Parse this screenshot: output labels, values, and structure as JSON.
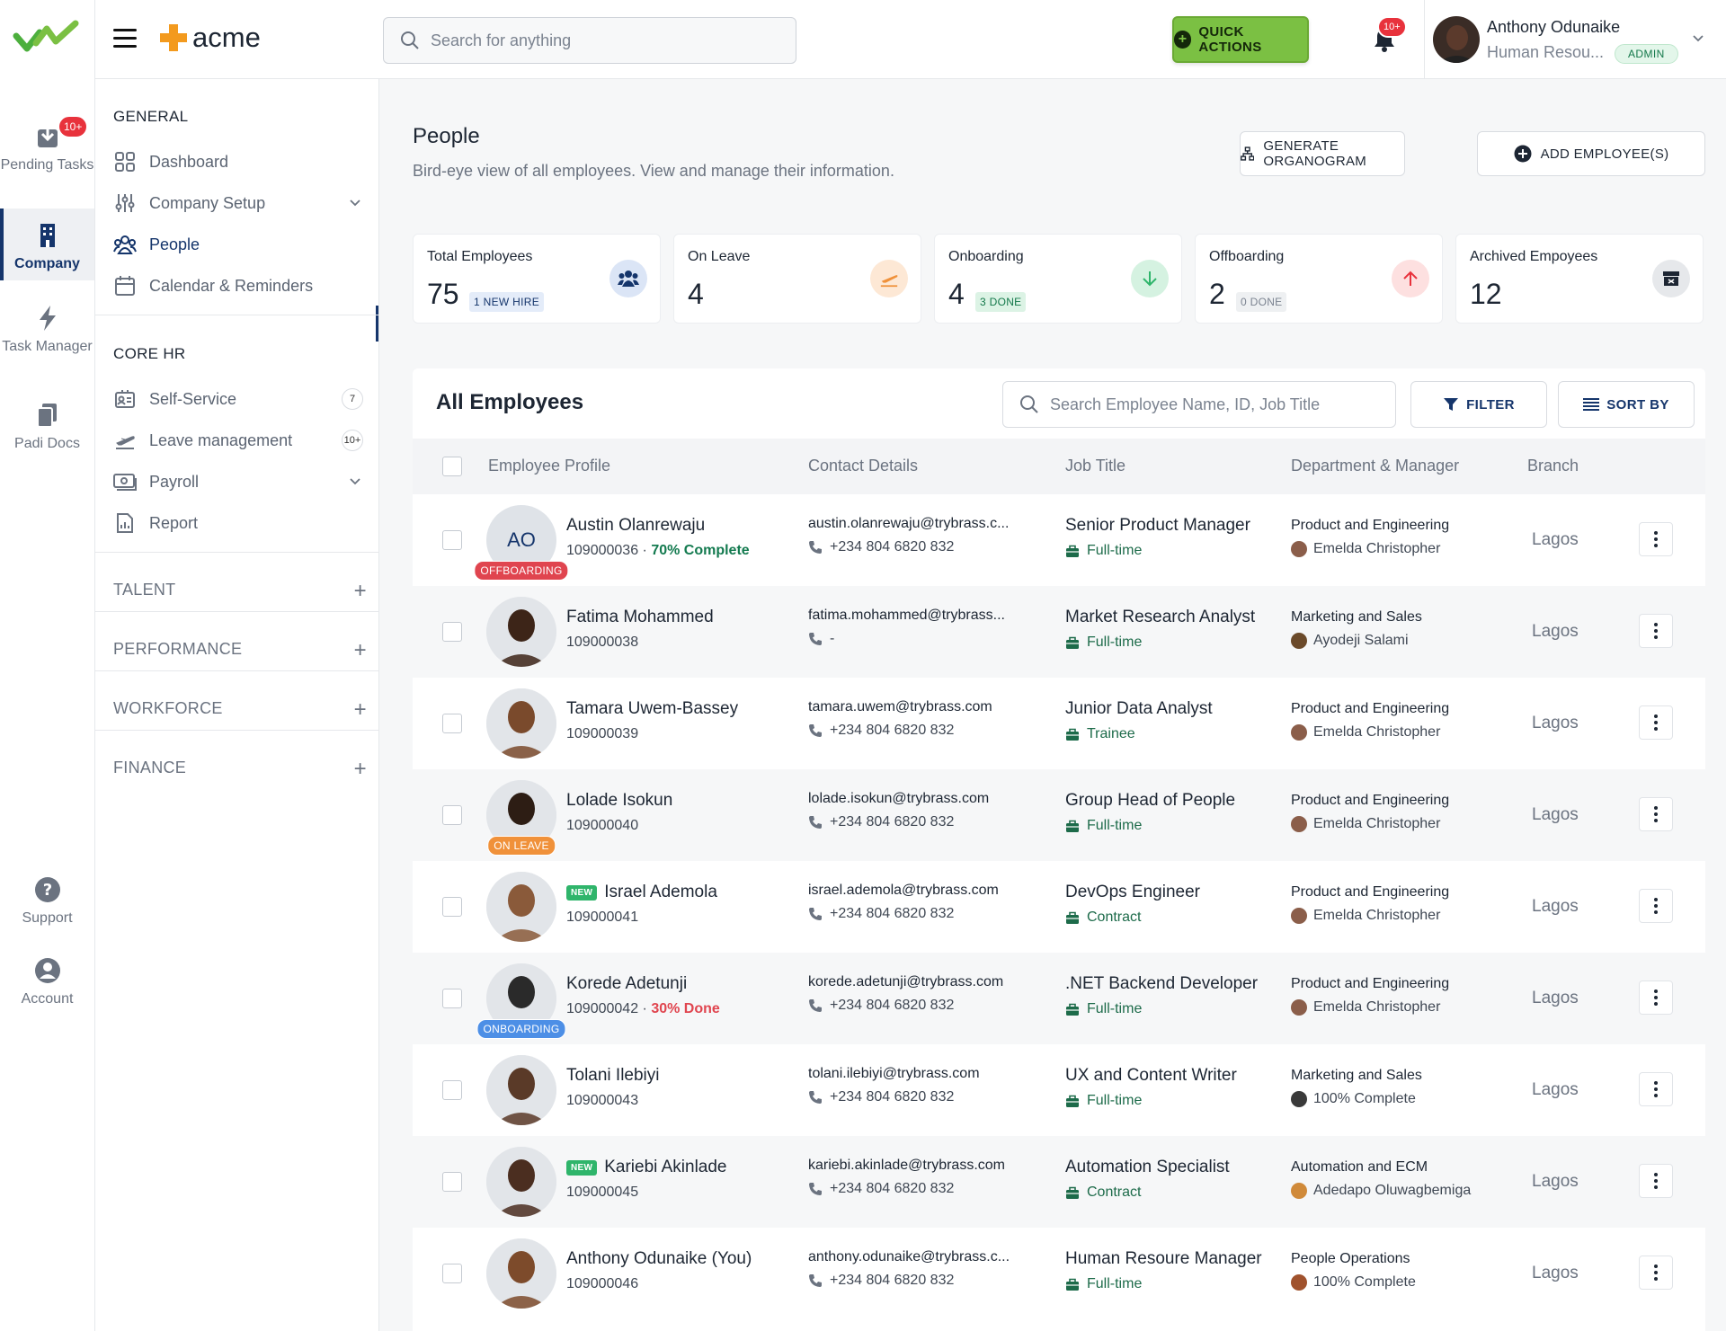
{
  "rail": {
    "pending_tasks": "Pending Tasks",
    "pending_badge": "10+",
    "company": "Company",
    "task_manager": "Task Manager",
    "padi_docs": "Padi Docs",
    "support": "Support",
    "account": "Account"
  },
  "topbar": {
    "brand": "acme",
    "search_placeholder": "Search for anything",
    "quick_actions": "QUICK ACTIONS",
    "notif_badge": "10+",
    "user_name": "Anthony Odunaike",
    "user_role": "Human Resou...",
    "role_badge": "ADMIN"
  },
  "sidebar": {
    "general_heading": "GENERAL",
    "general": [
      {
        "label": "Dashboard"
      },
      {
        "label": "Company Setup"
      },
      {
        "label": "People"
      },
      {
        "label": "Calendar & Reminders"
      }
    ],
    "core_heading": "CORE HR",
    "core": [
      {
        "label": "Self-Service",
        "count": "7"
      },
      {
        "label": "Leave management",
        "count": "10+"
      },
      {
        "label": "Payroll"
      },
      {
        "label": "Report"
      }
    ],
    "sections": [
      "TALENT",
      "PERFORMANCE",
      "WORKFORCE",
      "FINANCE"
    ]
  },
  "page": {
    "title": "People",
    "subtitle": "Bird-eye view of all employees. View and manage their information.",
    "generate_organogram": "GENERATE ORGANOGRAM",
    "add_employee": "ADD EMPLOYEE(S)"
  },
  "stats": [
    {
      "label": "Total Employees",
      "value": "75",
      "pill": "1 NEW HIRE"
    },
    {
      "label": "On Leave",
      "value": "4",
      "pill": ""
    },
    {
      "label": "Onboarding",
      "value": "4",
      "pill": "3 DONE"
    },
    {
      "label": "Offboarding",
      "value": "2",
      "pill": "0 DONE"
    },
    {
      "label": "Archived Empoyees",
      "value": "12",
      "pill": ""
    }
  ],
  "table": {
    "title": "All Employees",
    "search_placeholder": "Search Employee Name, ID, Job Title",
    "filter": "FILTER",
    "sort": "SORT BY",
    "columns": [
      "Employee Profile",
      "Contact Details",
      "Job Title",
      "Department & Manager",
      "Branch"
    ],
    "rows": [
      {
        "initials": "AO",
        "name": "Austin Olanrewaju",
        "new": "",
        "id": "109000036",
        "progress": "70% Complete",
        "progress_color": "#137a4f",
        "status": "OFFBOARDING",
        "status_color": "#e0454f",
        "email": "austin.olanrewaju@trybrass.c...",
        "phone": "+234 804 6820 832",
        "job": "Senior Product Manager",
        "type": "Full-time",
        "dept": "Product and Engineering",
        "manager": "Emelda Christopher",
        "branch": "Lagos"
      },
      {
        "initials": "",
        "name": "Fatima Mohammed",
        "new": "",
        "id": "109000038",
        "progress": "",
        "progress_color": "",
        "status": "",
        "status_color": "",
        "email": "fatima.mohammed@trybrass...",
        "phone": "-",
        "job": "Market Research Analyst",
        "type": "Full-time",
        "dept": "Marketing and Sales",
        "manager": "Ayodeji Salami",
        "branch": "Lagos"
      },
      {
        "initials": "",
        "name": "Tamara Uwem-Bassey",
        "new": "",
        "id": "109000039",
        "progress": "",
        "progress_color": "",
        "status": "",
        "status_color": "",
        "email": "tamara.uwem@trybrass.com",
        "phone": "+234 804 6820 832",
        "job": "Junior Data Analyst",
        "type": "Trainee",
        "dept": "Product and Engineering",
        "manager": "Emelda Christopher",
        "branch": "Lagos"
      },
      {
        "initials": "",
        "name": "Lolade Isokun",
        "new": "",
        "id": "109000040",
        "progress": "",
        "progress_color": "",
        "status": "ON LEAVE",
        "status_color": "#f0913a",
        "email": "lolade.isokun@trybrass.com",
        "phone": "+234 804 6820 832",
        "job": "Group Head of People",
        "type": "Full-time",
        "dept": "Product and Engineering",
        "manager": "Emelda Christopher",
        "branch": "Lagos"
      },
      {
        "initials": "",
        "name": "Israel Ademola",
        "new": "NEW",
        "id": "109000041",
        "progress": "",
        "progress_color": "",
        "status": "",
        "status_color": "",
        "email": "israel.ademola@trybrass.com",
        "phone": "+234 804 6820 832",
        "job": "DevOps Engineer",
        "type": "Contract",
        "dept": "Product and Engineering",
        "manager": "Emelda Christopher",
        "branch": "Lagos"
      },
      {
        "initials": "",
        "name": "Korede Adetunji",
        "new": "",
        "id": "109000042",
        "progress": "30% Done",
        "progress_color": "#e0454f",
        "status": "ONBOARDING",
        "status_color": "#4d8fe6",
        "email": "korede.adetunji@trybrass.com",
        "phone": "+234 804 6820 832",
        "job": ".NET Backend Developer",
        "type": "Full-time",
        "dept": "Product and Engineering",
        "manager": "Emelda Christopher",
        "branch": "Lagos"
      },
      {
        "initials": "",
        "name": "Tolani Ilebiyi",
        "new": "",
        "id": "109000043",
        "progress": "",
        "progress_color": "",
        "status": "",
        "status_color": "",
        "email": "tolani.ilebiyi@trybrass.com",
        "phone": "+234 804 6820 832",
        "job": "UX and Content Writer",
        "type": "Full-time",
        "dept": "Marketing and Sales",
        "manager": "100% Complete",
        "branch": "Lagos"
      },
      {
        "initials": "",
        "name": "Kariebi Akinlade",
        "new": "NEW",
        "id": "109000045",
        "progress": "",
        "progress_color": "",
        "status": "",
        "status_color": "",
        "email": "kariebi.akinlade@trybrass.com",
        "phone": "+234 804 6820 832",
        "job": "Automation Specialist",
        "type": "Contract",
        "dept": "Automation and ECM",
        "manager": "Adedapo Oluwagbemiga",
        "branch": "Lagos"
      },
      {
        "initials": "",
        "name": "Anthony Odunaike (You)",
        "new": "",
        "id": "109000046",
        "progress": "",
        "progress_color": "",
        "status": "",
        "status_color": "",
        "email": "anthony.odunaike@trybrass.c...",
        "phone": "+234 804 6820 832",
        "job": "Human Resoure Manager",
        "type": "Full-time",
        "dept": "People Operations",
        "manager": "100% Complete",
        "branch": "Lagos"
      }
    ]
  },
  "colors": {
    "navy": "#15356b",
    "green": "#7bc043",
    "orange": "#f0913a",
    "red": "#e8323c"
  }
}
